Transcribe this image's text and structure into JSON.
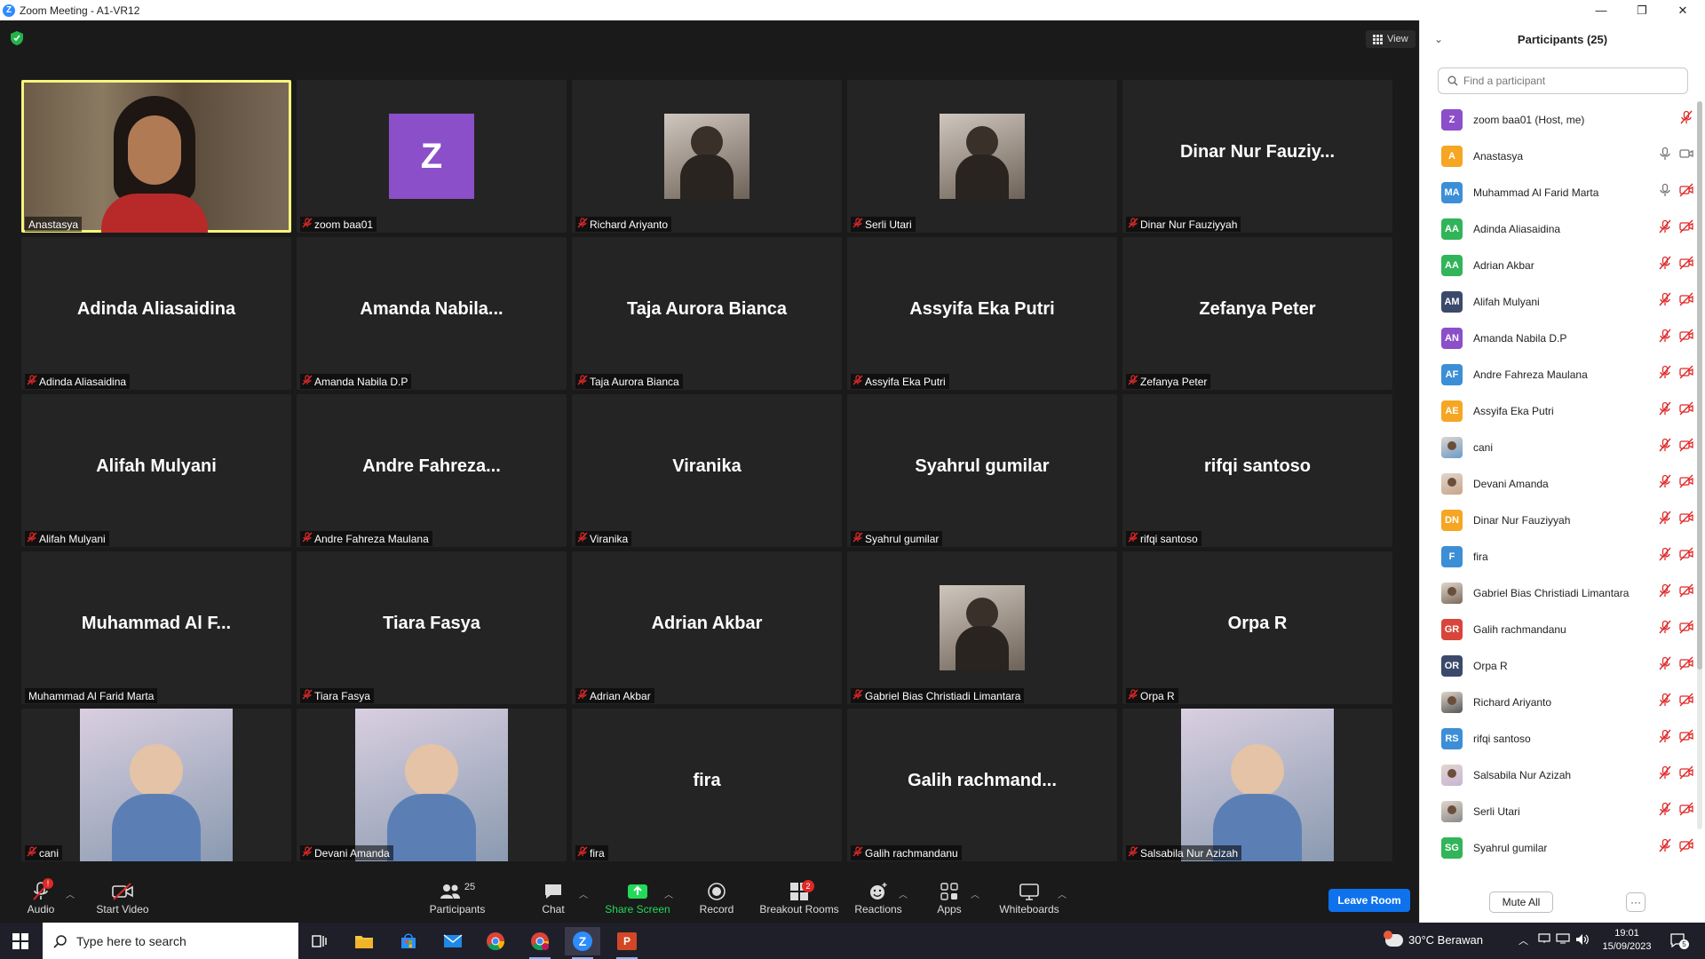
{
  "window": {
    "title": "Zoom Meeting - A1-VR12",
    "minimize": "—",
    "maximize": "❐",
    "close": "✕"
  },
  "meeting": {
    "view_label": "View",
    "tiles": [
      {
        "big": "",
        "caption": "Anastasya",
        "kind": "video-person",
        "muted": false,
        "active": true
      },
      {
        "big": "",
        "caption": "zoom baa01",
        "kind": "avatar-z",
        "avatar_letter": "Z",
        "muted": true
      },
      {
        "big": "",
        "caption": "Richard Ariyanto",
        "kind": "photo",
        "muted": true
      },
      {
        "big": "",
        "caption": "Serli Utari",
        "kind": "photo",
        "muted": true
      },
      {
        "big": "Dinar  Nur  Fauziy...",
        "caption": "Dinar Nur Fauziyyah",
        "muted": true
      },
      {
        "big": "Adinda Aliasaidina",
        "caption": "Adinda Aliasaidina",
        "muted": true
      },
      {
        "big": "Amanda  Nabila...",
        "caption": "Amanda Nabila D.P",
        "muted": true
      },
      {
        "big": "Taja Aurora Bianca",
        "caption": "Taja Aurora Bianca",
        "muted": true
      },
      {
        "big": "Assyifa Eka Putri",
        "caption": "Assyifa Eka Putri",
        "muted": true
      },
      {
        "big": "Zefanya Peter",
        "caption": "Zefanya Peter",
        "muted": true
      },
      {
        "big": "Alifah Mulyani",
        "caption": "Alifah Mulyani",
        "muted": true
      },
      {
        "big": "Andre  Fahreza...",
        "caption": "Andre Fahreza Maulana",
        "muted": true
      },
      {
        "big": "Viranika",
        "caption": "Viranika",
        "muted": true
      },
      {
        "big": "Syahrul gumilar",
        "caption": "Syahrul gumilar",
        "muted": true
      },
      {
        "big": "rifqi santoso",
        "caption": "rifqi santoso",
        "muted": true
      },
      {
        "big": "Muhammad  Al  F...",
        "caption": "Muhammad Al Farid Marta",
        "muted": false
      },
      {
        "big": "Tiara Fasya",
        "caption": "Tiara Fasya",
        "muted": true
      },
      {
        "big": "Adrian Akbar",
        "caption": "Adrian Akbar",
        "muted": true
      },
      {
        "big": "",
        "caption": "Gabriel Bias Christiadi Limantara",
        "kind": "photo",
        "muted": true
      },
      {
        "big": "Orpa R",
        "caption": "Orpa R",
        "muted": true
      },
      {
        "big": "",
        "caption": "cani",
        "kind": "photo-large",
        "muted": true
      },
      {
        "big": "",
        "caption": "Devani Amanda",
        "kind": "photo-large",
        "muted": true
      },
      {
        "big": "fira",
        "caption": "fira",
        "muted": true
      },
      {
        "big": "Galih  rachmand...",
        "caption": "Galih rachmandanu",
        "muted": true
      },
      {
        "big": "",
        "caption": "Salsabila Nur Azizah",
        "kind": "photo-large",
        "muted": true
      }
    ]
  },
  "toolbar": {
    "audio": "Audio",
    "start_video": "Start Video",
    "participants": "Participants",
    "participants_count": "25",
    "chat": "Chat",
    "share_screen": "Share Screen",
    "record": "Record",
    "breakout_rooms": "Breakout Rooms",
    "breakout_badge": "2",
    "reactions": "Reactions",
    "apps": "Apps",
    "whiteboards": "Whiteboards",
    "leave": "Leave Room",
    "audio_badge": "!"
  },
  "panel": {
    "title": "Participants (25)",
    "search_placeholder": "Find a participant",
    "mute_all": "Mute All",
    "more": "···",
    "participants": [
      {
        "initials": "Z",
        "name": "zoom baa01 (Host, me)",
        "color": "#8b4fc9",
        "mic": "muted",
        "video": false,
        "host": true
      },
      {
        "initials": "A",
        "name": "Anastasya",
        "color": "#f5a623",
        "mic": "on",
        "video": true
      },
      {
        "initials": "MA",
        "name": "Muhammad Al Farid Marta",
        "color": "#3c8fd6",
        "mic": "on",
        "video": false
      },
      {
        "initials": "AA",
        "name": "Adinda Aliasaidina",
        "color": "#32b45a",
        "mic": "muted",
        "video": false
      },
      {
        "initials": "AA",
        "name": "Adrian Akbar",
        "color": "#32b45a",
        "mic": "muted",
        "video": false
      },
      {
        "initials": "AM",
        "name": "Alifah Mulyani",
        "color": "#3b4a6b",
        "mic": "muted",
        "video": false
      },
      {
        "initials": "AN",
        "name": "Amanda Nabila D.P",
        "color": "#8b4fc9",
        "mic": "muted",
        "video": false
      },
      {
        "initials": "AF",
        "name": "Andre Fahreza Maulana",
        "color": "#3c8fd6",
        "mic": "muted",
        "video": false
      },
      {
        "initials": "AE",
        "name": "Assyifa Eka Putri",
        "color": "#f5a623",
        "mic": "muted",
        "video": false
      },
      {
        "initials": "",
        "name": "cani",
        "color": "#6a9bc9",
        "mic": "muted",
        "video": false,
        "photo": true
      },
      {
        "initials": "",
        "name": "Devani Amanda",
        "color": "#c9a48a",
        "mic": "muted",
        "video": false,
        "photo": true
      },
      {
        "initials": "DN",
        "name": "Dinar Nur Fauziyyah",
        "color": "#f5a623",
        "mic": "muted",
        "video": false
      },
      {
        "initials": "F",
        "name": "fira",
        "color": "#3c8fd6",
        "mic": "muted",
        "video": false
      },
      {
        "initials": "",
        "name": "Gabriel Bias Christiadi Limantara",
        "color": "#7a6a5a",
        "mic": "muted",
        "video": false,
        "photo": true
      },
      {
        "initials": "GR",
        "name": "Galih rachmandanu",
        "color": "#d9453b",
        "mic": "muted",
        "video": false
      },
      {
        "initials": "OR",
        "name": "Orpa R",
        "color": "#3b4a6b",
        "mic": "muted",
        "video": false
      },
      {
        "initials": "",
        "name": "Richard Ariyanto",
        "color": "#555555",
        "mic": "muted",
        "video": false,
        "photo": true
      },
      {
        "initials": "RS",
        "name": "rifqi santoso",
        "color": "#3c8fd6",
        "mic": "muted",
        "video": false
      },
      {
        "initials": "",
        "name": "Salsabila Nur Azizah",
        "color": "#c9b4d6",
        "mic": "muted",
        "video": false,
        "photo": true
      },
      {
        "initials": "",
        "name": "Serli Utari",
        "color": "#8a8a8a",
        "mic": "muted",
        "video": false,
        "photo": true
      },
      {
        "initials": "SG",
        "name": "Syahrul gumilar",
        "color": "#32b45a",
        "mic": "muted",
        "video": false
      }
    ]
  },
  "taskbar": {
    "search_placeholder": "Type here to search",
    "weather": "30°C  Berawan",
    "time": "19:01",
    "date": "15/09/2023",
    "notif_count": "5"
  },
  "colors": {
    "active_speaker": "#f5f57a",
    "accent": "#0e72ed",
    "muted_red": "#e02828",
    "share_green": "#23d959"
  }
}
